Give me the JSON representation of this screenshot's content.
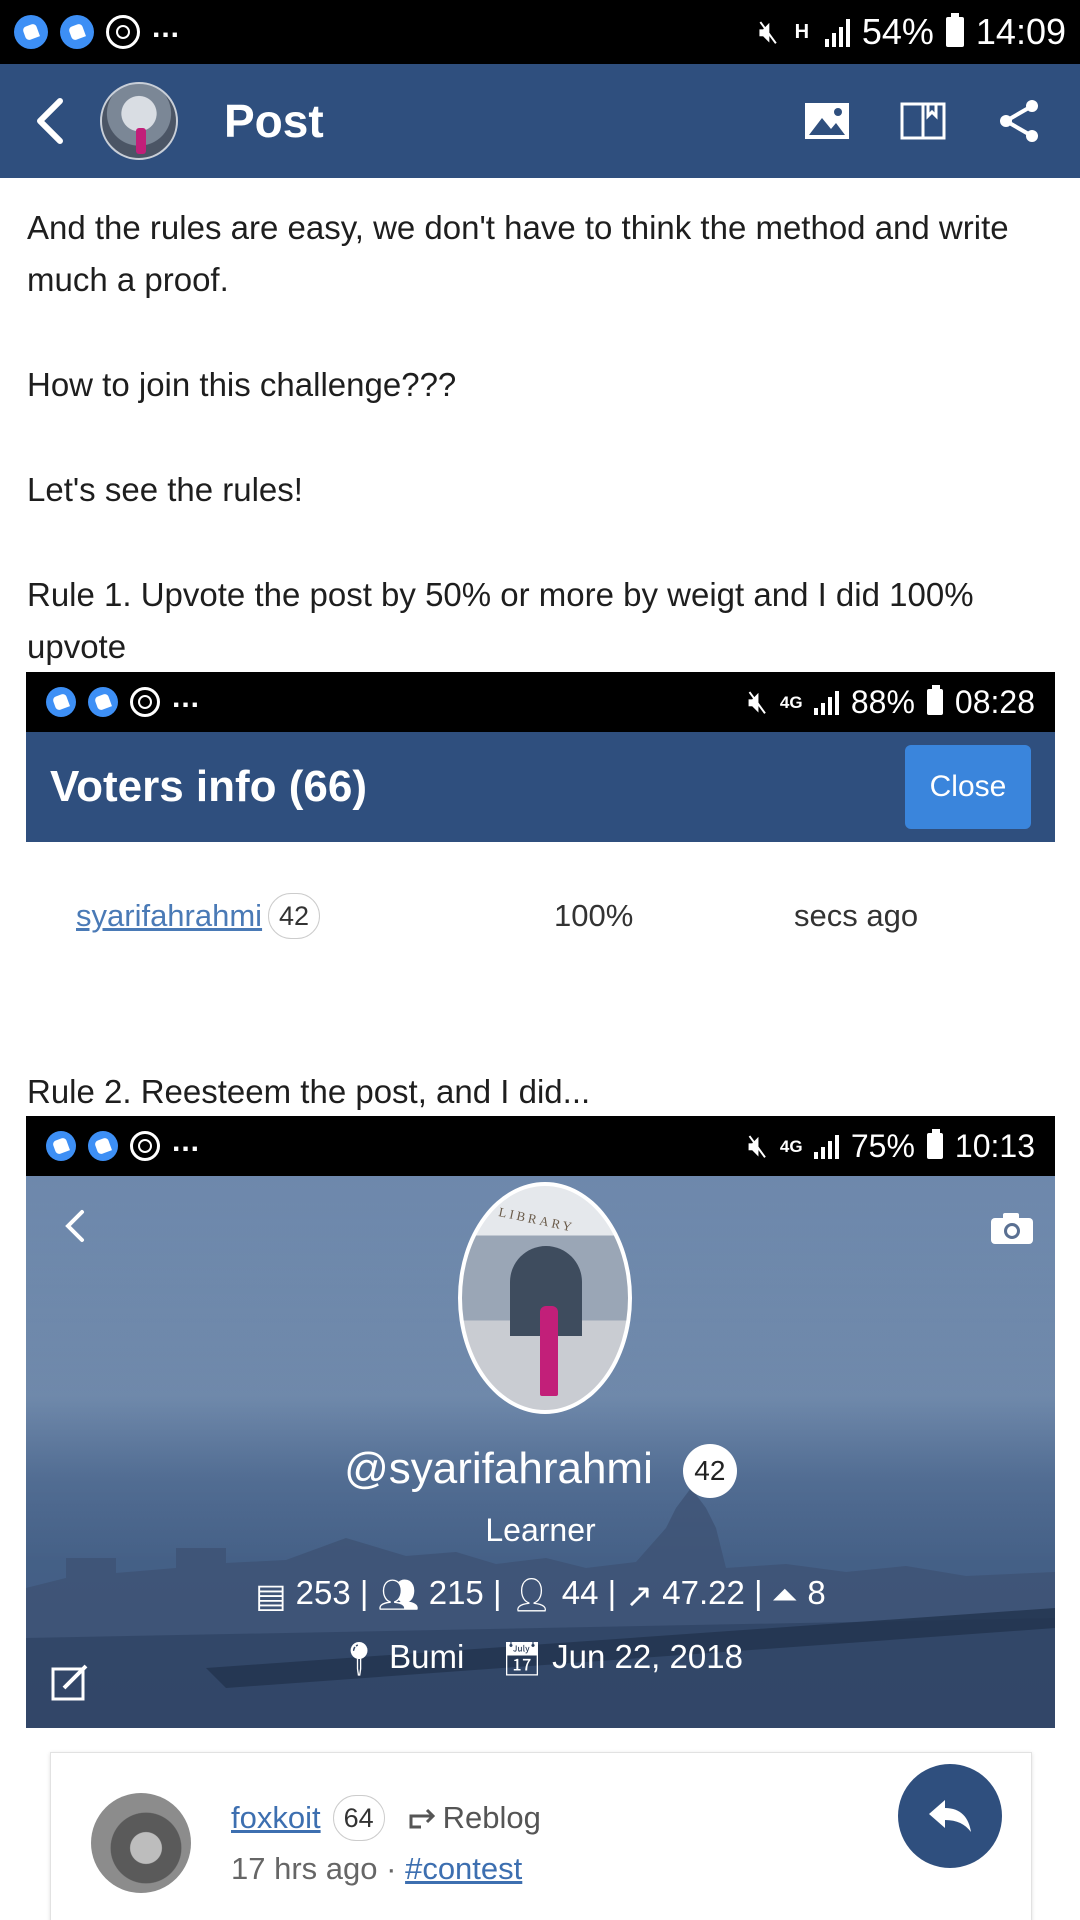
{
  "status_bar": {
    "battery": "54%",
    "time": "14:09",
    "network": "H",
    "more": "..."
  },
  "header": {
    "title": "Post"
  },
  "post": {
    "para1": "And the rules are easy, we don't have to think the method and write much a proof.",
    "para2": "How to join this challenge???",
    "para3": "Let's see the rules!",
    "rule1": "Rule 1. Upvote the post by 50% or more by weigt and I did 100% upvote",
    "rule2": "Rule 2. Reesteem the post, and I did..."
  },
  "screenshot1": {
    "status": {
      "network": "4G",
      "battery": "88%",
      "time": "08:28",
      "more": "..."
    },
    "title": "Voters info (66)",
    "close_label": "Close",
    "voter": {
      "name": "syarifahrahmi",
      "rep": "42",
      "percent": "100%",
      "time": "secs ago"
    }
  },
  "screenshot2": {
    "status": {
      "network": "4G",
      "battery": "75%",
      "time": "10:13",
      "more": "..."
    },
    "avatar_text": "LIBRARY",
    "handle": "@syarifahrahmi",
    "rep": "42",
    "role": "Learner",
    "stats": {
      "posts": "253",
      "followers": "215",
      "following": "44",
      "sp": "47.22",
      "votes": "8"
    },
    "location": "Bumi",
    "joined": "Jun 22, 2018"
  },
  "reblog_card": {
    "user": "foxkoit",
    "rep": "64",
    "reblog_label": "Reblog",
    "time": "17 hrs ago",
    "separator": "·",
    "tag": "#contest"
  },
  "colors": {
    "header_bg": "#2f4f7e",
    "link": "#3d6fb0",
    "close_btn": "#3a85dc"
  },
  "icons": [
    "back-icon",
    "image-icon",
    "book-icon",
    "share-icon",
    "camera-icon",
    "edit-icon",
    "reply-icon",
    "reblog-icon",
    "location-icon",
    "calendar-icon"
  ]
}
